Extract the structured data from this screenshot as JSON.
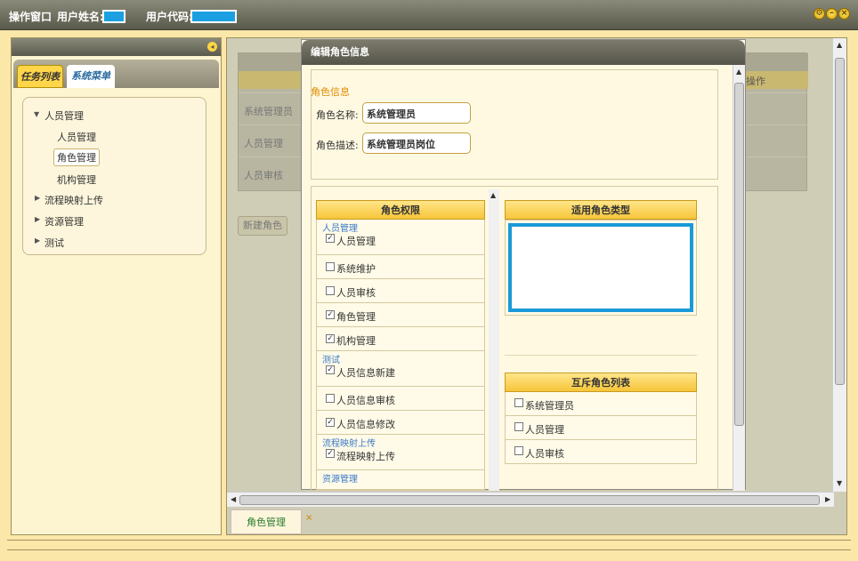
{
  "titlebar": {
    "window_label": "操作窗口",
    "user_name_label": "用户姓名:",
    "user_code_label": "用户代码:"
  },
  "left_panel": {
    "tabs": [
      {
        "label": "任务列表"
      },
      {
        "label": "系统菜单"
      }
    ],
    "tree": [
      {
        "label": "人员管理",
        "expanded": true
      },
      {
        "label": "人员管理"
      },
      {
        "label": "角色管理",
        "selected": true
      },
      {
        "label": "机构管理"
      },
      {
        "label": "流程映射上传"
      },
      {
        "label": "资源管理"
      },
      {
        "label": "测试"
      }
    ]
  },
  "main": {
    "bg_table": {
      "header_action": "操作",
      "rows": [
        "系统管理员",
        "人员管理",
        "人员审核"
      ]
    },
    "new_role_button": "新建角色",
    "bottom_tab": {
      "label": "角色管理",
      "close": "×"
    }
  },
  "dialog": {
    "title": "编辑角色信息",
    "section_legend": "角色信息",
    "name_label": "角色名称:",
    "name_value": "系统管理员",
    "desc_label": "角色描述:",
    "desc_value": "系统管理员岗位",
    "perm_header": "角色权限",
    "permissions": [
      {
        "group": "人员管理",
        "label": "人员管理",
        "checked": true
      },
      {
        "label": "系统维护",
        "checked": false
      },
      {
        "label": "人员审核",
        "checked": false
      },
      {
        "label": "角色管理",
        "checked": true
      },
      {
        "label": "机构管理",
        "checked": true
      },
      {
        "group": "测试",
        "label": "人员信息新建",
        "checked": true
      },
      {
        "label": "人员信息审核",
        "checked": false
      },
      {
        "label": "人员信息修改",
        "checked": true
      },
      {
        "group": "流程映射上传",
        "label": "流程映射上传",
        "checked": true
      },
      {
        "group": "资源管理",
        "label": "",
        "checked": false
      }
    ],
    "role_type_header": "适用角色类型",
    "mutex_header": "互斥角色列表",
    "mutex_roles": [
      {
        "label": "系统管理员",
        "checked": false
      },
      {
        "label": "人员管理",
        "checked": false
      },
      {
        "label": "人员审核",
        "checked": false
      }
    ]
  },
  "colors": {
    "accent": "#ffd54a",
    "selection_blue": "#1a9ad8",
    "group_text": "#3a7ac8"
  }
}
